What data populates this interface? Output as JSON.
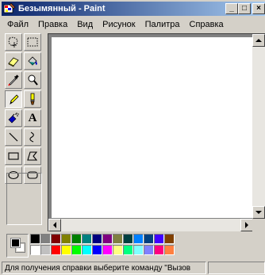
{
  "window": {
    "title": "Безымянный - Paint",
    "controls": {
      "minimize": "_",
      "maximize": "□",
      "close": "×"
    }
  },
  "menu": {
    "items": [
      "Файл",
      "Правка",
      "Вид",
      "Рисунок",
      "Палитра",
      "Справка"
    ]
  },
  "tools": [
    {
      "name": "free-form-select",
      "icon": "free-select-icon"
    },
    {
      "name": "select",
      "icon": "rect-select-icon"
    },
    {
      "name": "eraser",
      "icon": "eraser-icon"
    },
    {
      "name": "fill",
      "icon": "fill-bucket-icon"
    },
    {
      "name": "pick-color",
      "icon": "eyedropper-icon"
    },
    {
      "name": "magnifier",
      "icon": "magnifier-icon"
    },
    {
      "name": "pencil",
      "icon": "pencil-icon",
      "selected": true
    },
    {
      "name": "brush",
      "icon": "brush-icon"
    },
    {
      "name": "airbrush",
      "icon": "airbrush-icon"
    },
    {
      "name": "text",
      "icon": "text-icon",
      "glyph": "A"
    },
    {
      "name": "line",
      "icon": "line-icon"
    },
    {
      "name": "curve",
      "icon": "curve-icon"
    },
    {
      "name": "rectangle",
      "icon": "rectangle-icon"
    },
    {
      "name": "polygon",
      "icon": "polygon-icon"
    },
    {
      "name": "ellipse",
      "icon": "ellipse-icon"
    },
    {
      "name": "rounded-rectangle",
      "icon": "rounded-rectangle-icon"
    }
  ],
  "colors": {
    "foreground": "#000000",
    "background": "#ffffff",
    "palette_top": [
      "#000000",
      "#808080",
      "#800000",
      "#808000",
      "#008000",
      "#008080",
      "#000080",
      "#800080",
      "#808040",
      "#004040",
      "#0080ff",
      "#004080",
      "#4000ff",
      "#804000"
    ],
    "palette_bottom": [
      "#ffffff",
      "#c0c0c0",
      "#ff0000",
      "#ffff00",
      "#00ff00",
      "#00ffff",
      "#0000ff",
      "#ff00ff",
      "#ffff80",
      "#00ff80",
      "#80ffff",
      "#8080ff",
      "#ff0080",
      "#ff8040"
    ]
  },
  "status": {
    "help_text": "Для получения справки выберите команду \"Вызов",
    "position": ""
  }
}
